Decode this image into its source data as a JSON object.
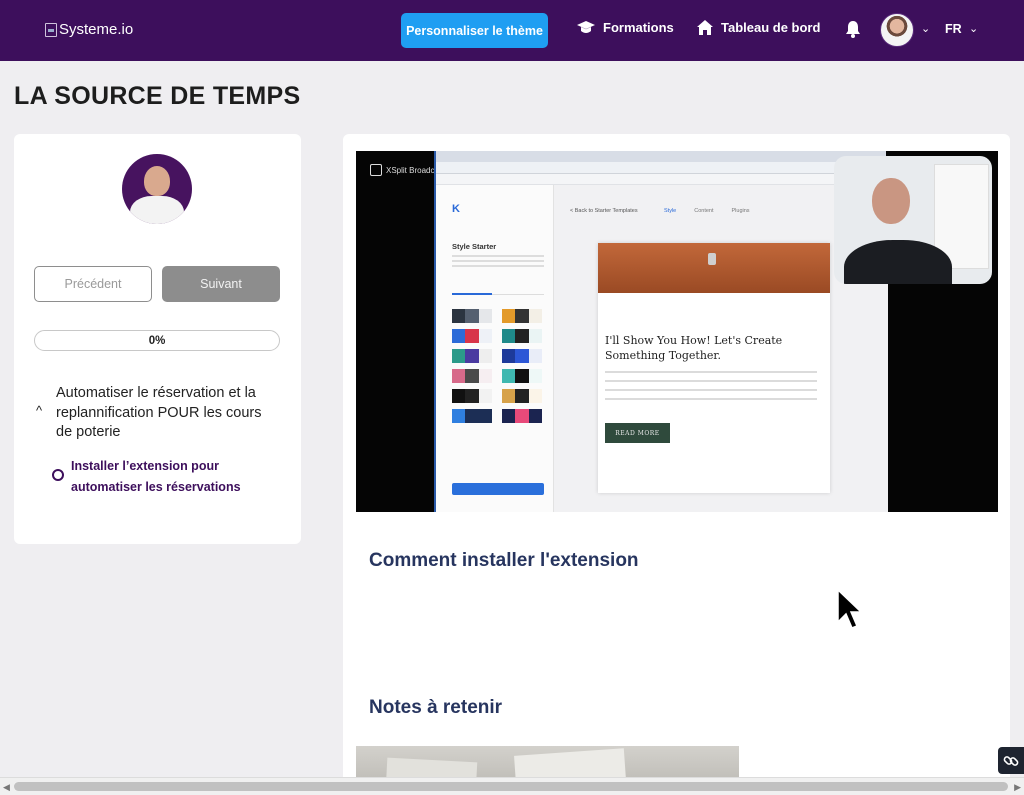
{
  "header": {
    "logo_alt": "Systeme.io",
    "theme_button": "Personnaliser le thème",
    "nav": {
      "formations": "Formations",
      "dashboard": "Tableau de bord"
    },
    "language": "FR",
    "colors": {
      "bar": "#3d0f5c",
      "accent": "#1f9ef2"
    }
  },
  "page": {
    "title": "LA SOURCE DE TEMPS"
  },
  "sidebar": {
    "prev_label": "Précédent",
    "next_label": "Suivant",
    "progress_label": "0%",
    "progress_value": 0,
    "module_title": "Automatiser le réservation et la replannification POUR les cours de poterie",
    "lesson_title": "Installer l’extension pour automatiser les réservations"
  },
  "video": {
    "overlay_app": "XSplit Broadc",
    "editor_title": "Style Starter",
    "editor_back": "< Back to Starter Templates",
    "steps": [
      "Style",
      "Content",
      "Plugins"
    ],
    "preview_headline": "I'll Show You How! Let's Create Something Together.",
    "preview_button": "READ MORE"
  },
  "content": {
    "section_install": "Comment installer l'extension",
    "section_notes": "Notes à retenir"
  },
  "icons": {
    "formations": "graduation-cap-icon",
    "dashboard": "home-icon",
    "bell": "bell-icon",
    "chevron": "chevron-down-icon",
    "link": "link-icon"
  }
}
